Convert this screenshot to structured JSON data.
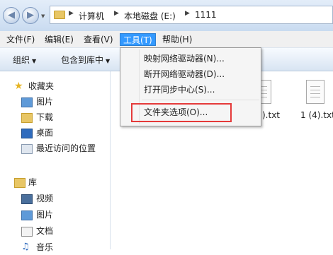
{
  "breadcrumb": {
    "items": [
      "计算机",
      "本地磁盘 (E:)",
      "1111"
    ]
  },
  "menubar": {
    "items": [
      "文件(F)",
      "编辑(E)",
      "查看(V)",
      "工具(T)",
      "帮助(H)"
    ]
  },
  "toolbar": {
    "organize": "组织",
    "include": "包含到库中"
  },
  "navpane": {
    "favorites": "收藏夹",
    "fav_items": [
      "图片",
      "下载",
      "桌面",
      "最近访问的位置"
    ],
    "libraries": "库",
    "lib_items": [
      "视频",
      "图片",
      "文档",
      "音乐"
    ]
  },
  "files": [
    {
      "label": ").txt"
    },
    {
      "label": "1 (4).txt"
    }
  ],
  "tools_menu": {
    "items": [
      "映射网络驱动器(N)...",
      "断开网络驱动器(D)...",
      "打开同步中心(S)...",
      "文件夹选项(O)..."
    ]
  }
}
